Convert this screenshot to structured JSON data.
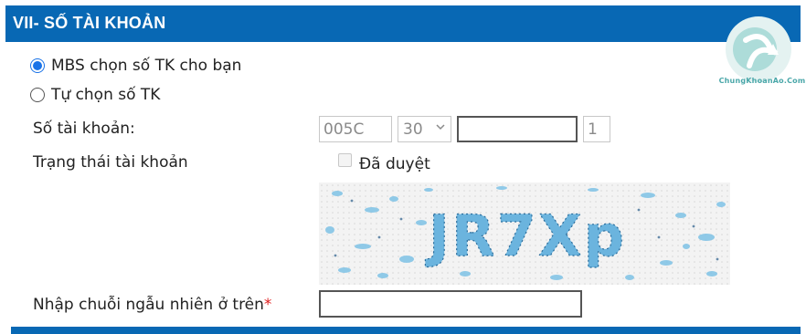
{
  "section": {
    "title": "VII- SỐ TÀI KHOẢN"
  },
  "account_choice": {
    "options": [
      {
        "label": "MBS chọn số TK cho bạn",
        "selected": true
      },
      {
        "label": "Tự chọn số TK",
        "selected": false
      }
    ]
  },
  "account_number": {
    "label": "Số tài khoản:",
    "prefix_value": "005C",
    "type_selected": "30",
    "number_value": "",
    "suffix_value": "1"
  },
  "account_status": {
    "label": "Trạng thái tài khoản",
    "checkbox_label": "Đã duyệt",
    "checked": false
  },
  "captcha": {
    "text": "JR7Xp",
    "input_label": "Nhập chuỗi ngẫu nhiên ở trên",
    "required_mark": "*",
    "input_value": ""
  },
  "watermark": {
    "text": "ChungKhoanAo.Com"
  },
  "colors": {
    "header_bg": "#0868b4",
    "radio_accent": "#1a73e8",
    "required": "#e02020",
    "captcha_ink": "#4f9fd0",
    "watermark": "#4aa7a9"
  }
}
